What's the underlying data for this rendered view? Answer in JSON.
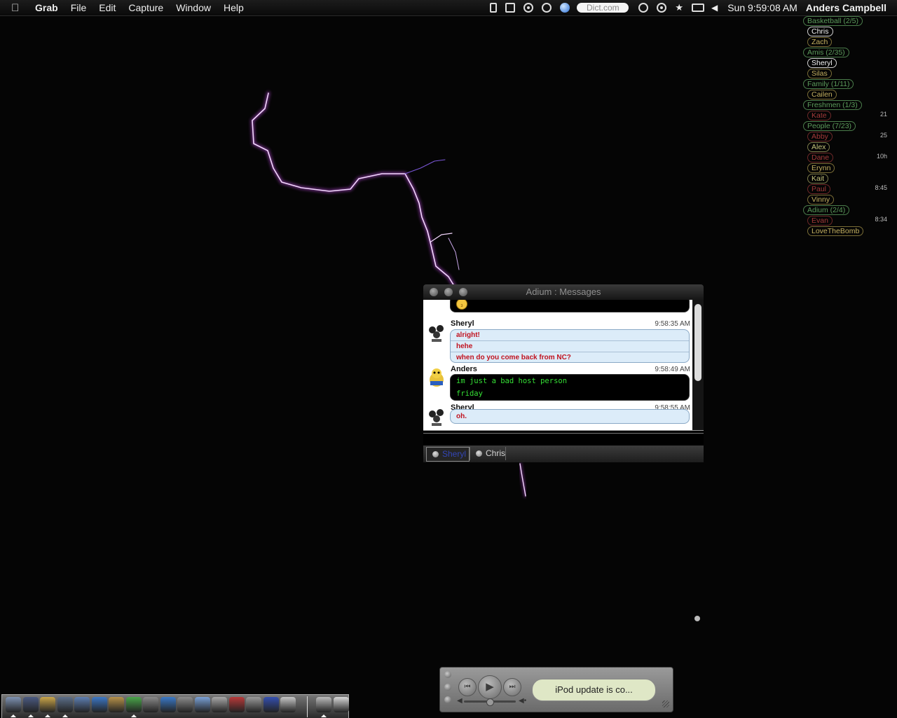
{
  "menubar": {
    "apple": "",
    "app_name": "Grab",
    "menus": [
      "File",
      "Edit",
      "Capture",
      "Window",
      "Help"
    ],
    "status_icons": [
      "ipod-icon",
      "display-icon",
      "spotlight-icon",
      "cd-icon",
      "globe-icon",
      "applescript-icon",
      "network-icon",
      "bluetooth-icon",
      "airport-icon",
      "volume-icon"
    ],
    "dict_field": "Dict.com",
    "clock": "Sun 9:59:08 AM",
    "user": "Anders Campbell"
  },
  "buddy_list": {
    "rows": [
      {
        "type": "group",
        "label": "Basketball (2/5)",
        "time": ""
      },
      {
        "type": "contact",
        "label": "Chris",
        "status": "selected",
        "time": ""
      },
      {
        "type": "contact",
        "label": "Zach",
        "status": "away",
        "time": ""
      },
      {
        "type": "group",
        "label": "Amis (2/35)",
        "time": ""
      },
      {
        "type": "contact",
        "label": "Sheryl",
        "status": "selected",
        "time": ""
      },
      {
        "type": "contact",
        "label": "Silas",
        "status": "away",
        "time": ""
      },
      {
        "type": "group",
        "label": "Family (1/11)",
        "time": ""
      },
      {
        "type": "contact",
        "label": "Cailen",
        "status": "away",
        "time": ""
      },
      {
        "type": "group",
        "label": "Freshmen (1/3)",
        "time": ""
      },
      {
        "type": "contact",
        "label": "Kate",
        "status": "idle",
        "time": "21"
      },
      {
        "type": "group",
        "label": "People (7/23)",
        "time": ""
      },
      {
        "type": "contact",
        "label": "Abby",
        "status": "idle",
        "time": "25"
      },
      {
        "type": "contact",
        "label": "Alex",
        "status": "online",
        "time": ""
      },
      {
        "type": "contact",
        "label": "Dane",
        "status": "idle",
        "time": "10h"
      },
      {
        "type": "contact",
        "label": "Erynn",
        "status": "away",
        "time": ""
      },
      {
        "type": "contact",
        "label": "Kait",
        "status": "online",
        "time": ""
      },
      {
        "type": "contact",
        "label": "Paul",
        "status": "idle",
        "time": "8:45"
      },
      {
        "type": "contact",
        "label": "Vinny",
        "status": "away",
        "time": ""
      },
      {
        "type": "group",
        "label": "Adium (2/4)",
        "time": ""
      },
      {
        "type": "contact",
        "label": "Evan",
        "status": "idle",
        "time": "8:34"
      },
      {
        "type": "contact",
        "label": "LoveTheBomb",
        "status": "away",
        "time": ""
      }
    ]
  },
  "chat": {
    "title": "Adium : Messages",
    "messages": [
      {
        "sender": "Sheryl",
        "time": "9:58:35 AM",
        "lines": [
          "alright!",
          "hehe",
          "when do you come back from NC?"
        ]
      },
      {
        "sender": "Anders",
        "time": "9:58:49 AM",
        "lines": [
          "im just a bad host person",
          "friday"
        ]
      },
      {
        "sender": "Sheryl",
        "time": "9:58:55 AM",
        "lines": [
          "oh."
        ]
      }
    ],
    "tabs": [
      {
        "label": "Sheryl"
      },
      {
        "label": "Chris"
      }
    ]
  },
  "dock": {
    "icons": [
      "finder-icon",
      "dashboard-icon",
      "adium-icon",
      "clock-icon",
      "safari-icon",
      "word-icon",
      "notes-icon",
      "itunes-icon",
      "utility-icon",
      "mail-icon",
      "network-icon",
      "preview-icon",
      "system-preferences-icon",
      "tools-icon",
      "search-icon",
      "globe-icon",
      "widget-icon",
      "folder-icon",
      "trash-icon"
    ],
    "colors": [
      "#7f93b3",
      "#4b5a82",
      "#caa64a",
      "#5c6f8a",
      "#5e7fb2",
      "#3d78c6",
      "#b7924a",
      "#4aa64a",
      "#8a8a8a",
      "#3b79c7",
      "#8c8c8c",
      "#7aa1d6",
      "#a7a7a7",
      "#b83a3a",
      "#9a9a9a",
      "#3550b0",
      "#c7c7c7",
      "#bbbbbb",
      "#d9d9d9"
    ]
  },
  "itunes": {
    "lcd_text": "iPod update is co...",
    "controls": [
      "previous",
      "play",
      "next"
    ],
    "volume": 0.5
  }
}
